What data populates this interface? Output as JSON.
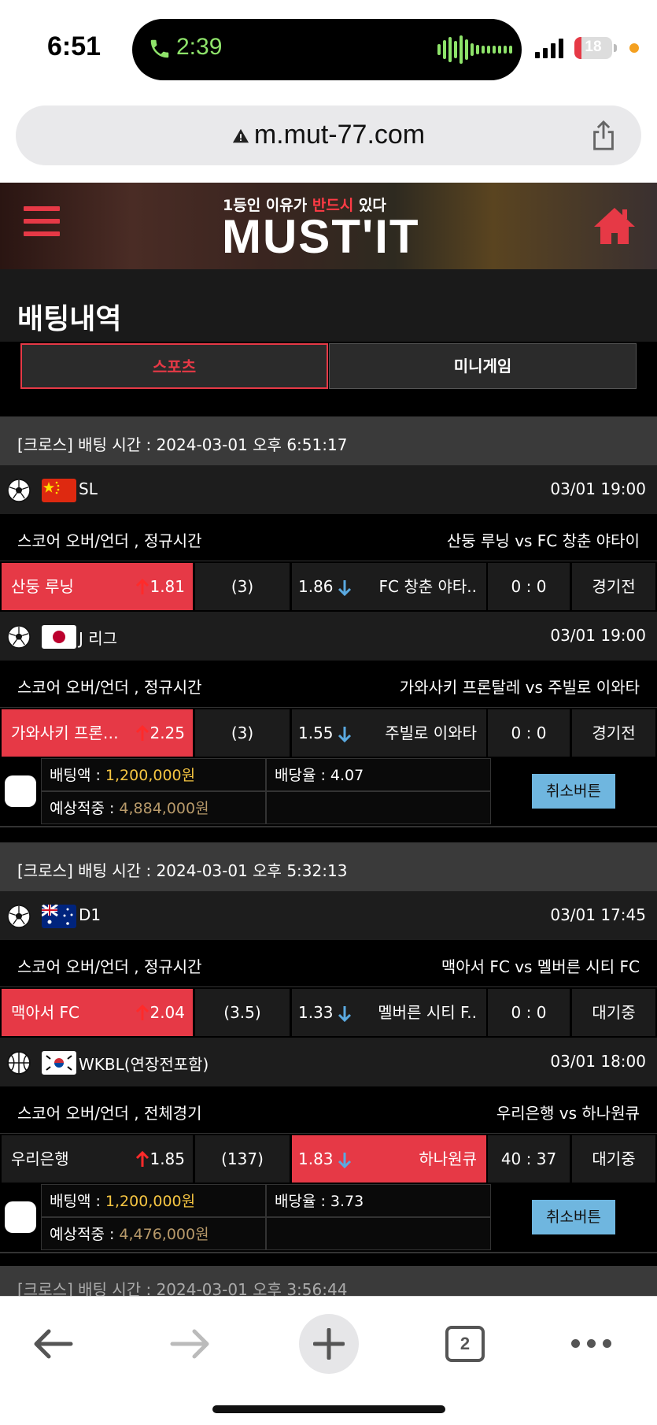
{
  "status_bar": {
    "time": "6:51",
    "call_time": "2:39",
    "battery": "18",
    "battery_level": 0.18
  },
  "browser": {
    "url": "m.mut-77.com",
    "tab_count": "2"
  },
  "header": {
    "tagline_pre": "1등인 이유가 ",
    "tagline_highlight": "반드시",
    "tagline_post": " 있다",
    "logo": "MUST'IT",
    "accent": "#e63946"
  },
  "page": {
    "title": "배팅내역"
  },
  "tabs": [
    {
      "label": "스포츠",
      "active": true
    },
    {
      "label": "미니게임",
      "active": false
    }
  ],
  "labels": {
    "bet_amount": "배팅액 : ",
    "odds": "배당율 : ",
    "expected": "예상적중 : ",
    "cancel": "취소버튼"
  },
  "bets": [
    {
      "header": "[크로스] 배팅 시간 : 2024-03-01 오후 6:51:17",
      "games": [
        {
          "sport_icon": "soccer-ball-icon",
          "flag": "china-flag-icon",
          "league": "SL",
          "datetime": "03/01 19:00",
          "market": "스코어 오버/언더 , 정규시간",
          "matchup": "산둥 루닝  vs  FC 창춘 야타이",
          "home": "산둥 루닝",
          "home_odds": "1.81",
          "line": "(3)",
          "away_odds": "1.86",
          "away": "FC 창춘 야타..",
          "score": "0 : 0",
          "status": "경기전",
          "selected": "home"
        },
        {
          "sport_icon": "soccer-ball-icon",
          "flag": "japan-flag-icon",
          "league": "J 리그",
          "datetime": "03/01 19:00",
          "market": "스코어 오버/언더 , 정규시간",
          "matchup": "가와사키 프론탈레  vs  주빌로 이와타",
          "home": "가와사키 프론…",
          "home_odds": "2.25",
          "line": "(3)",
          "away_odds": "1.55",
          "away": "주빌로 이와타",
          "score": "0 : 0",
          "status": "경기전",
          "selected": "home"
        }
      ],
      "amount": "1,200,000원",
      "odds": "4.07",
      "expected": "4,884,000원"
    },
    {
      "header": "[크로스] 배팅 시간 : 2024-03-01 오후 5:32:13",
      "games": [
        {
          "sport_icon": "soccer-ball-icon",
          "flag": "australia-flag-icon",
          "league": "D1",
          "datetime": "03/01 17:45",
          "market": "스코어 오버/언더 , 정규시간",
          "matchup": "맥아서 FC  vs  멜버른 시티 FC",
          "home": "맥아서 FC",
          "home_odds": "2.04",
          "line": "(3.5)",
          "away_odds": "1.33",
          "away": "멜버른 시티 F..",
          "score": "0 : 0",
          "status": "대기중",
          "selected": "home"
        },
        {
          "sport_icon": "basketball-icon",
          "flag": "korea-flag-icon",
          "league": "WKBL(연장전포함)",
          "datetime": "03/01 18:00",
          "market": "스코어 오버/언더 , 전체경기",
          "matchup": "우리은행  vs  하나원큐",
          "home": "우리은행",
          "home_odds": "1.85",
          "line": "(137)",
          "away_odds": "1.83",
          "away": "하나원큐",
          "score": "40 : 37",
          "status": "대기중",
          "selected": "away"
        }
      ],
      "amount": "1,200,000원",
      "odds": "3.73",
      "expected": "4,476,000원"
    }
  ],
  "next_header_peek": "[크로스] 배팅 시간 : 2024-03-01 오후 3:56:44"
}
